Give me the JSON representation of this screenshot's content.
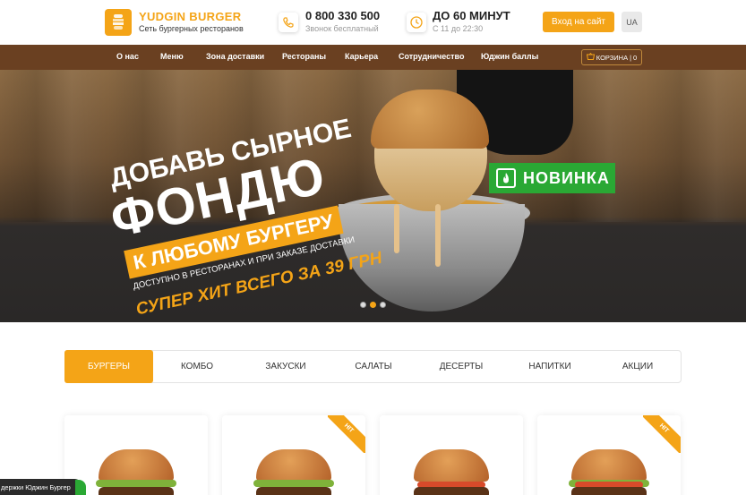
{
  "header": {
    "brand_name": "YUDGIN BURGER",
    "brand_tagline": "Сеть бургерных ресторанов",
    "phone": "0 800 330 500",
    "phone_note": "Звонок бесплатный",
    "delivery_time": "ДО 60 МИНУТ",
    "delivery_hours": "С 11 до 22:30",
    "login_label": "Вход на сайт",
    "lang_label": "UA"
  },
  "nav": {
    "items": [
      "О нас",
      "Меню",
      "Зона доставки",
      "Рестораны",
      "Карьера",
      "Сотрудничество",
      "Юджин баллы"
    ],
    "cart_label": "КОРЗИНА",
    "cart_count": "0"
  },
  "hero": {
    "line1": "ДОБАВЬ СЫРНОЕ",
    "line2": "ФОНДЮ",
    "line3": "К ЛЮБОМУ БУРГЕРУ",
    "line4": "ДОСТУПНО В РЕСТОРАНАХ И ПРИ ЗАКАЗЕ ДОСТАВКИ",
    "line5": "СУПЕР ХИТ ВСЕГО ЗА 39 ГРН",
    "badge": "НОВИНКА",
    "slides_total": 3,
    "slide_active": 2
  },
  "categories": {
    "items": [
      "БУРГЕРЫ",
      "КОМБО",
      "ЗАКУСКИ",
      "САЛАТЫ",
      "ДЕСЕРТЫ",
      "НАПИТКИ",
      "АКЦИИ"
    ],
    "active": "БУРГЕРЫ"
  },
  "products": {
    "hit_label": "HIT"
  },
  "support": {
    "label": "держки Юджин Бургер"
  },
  "colors": {
    "accent": "#f4a417",
    "nav_bg": "#6a4021",
    "new_badge": "#2aa834"
  }
}
